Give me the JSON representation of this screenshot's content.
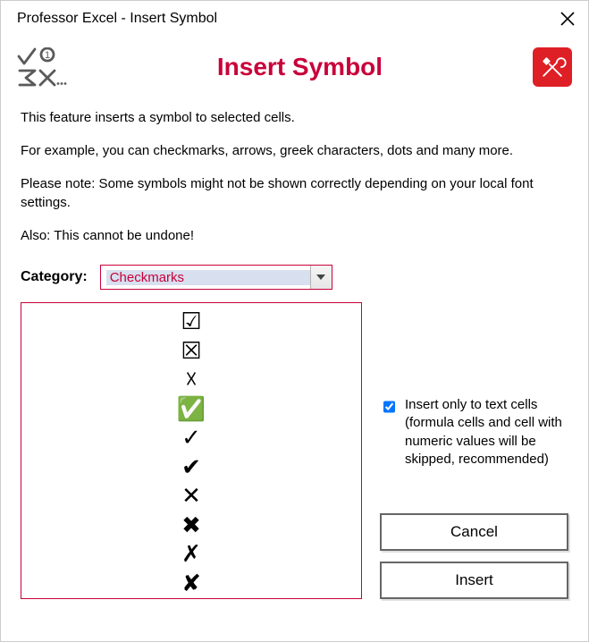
{
  "window": {
    "title": "Professor Excel - Insert Symbol"
  },
  "header": {
    "title": "Insert Symbol"
  },
  "description": {
    "p1": "This feature inserts a symbol to selected cells.",
    "p2": "For example, you can checkmarks, arrows, greek characters, dots and many more.",
    "p3": "Please note: Some symbols might not be shown correctly depending on your local font settings.",
    "p4": "Also: This cannot be undone!"
  },
  "category": {
    "label": "Category:",
    "value": "Checkmarks"
  },
  "symbols": [
    "☑",
    "☒",
    "☓",
    "✅",
    "✓",
    "✔",
    "✕",
    "✖",
    "✗",
    "✘"
  ],
  "option": {
    "text": "Insert only to text cells (formula cells and cell with numeric values will be skipped, recommended)",
    "checked": true
  },
  "buttons": {
    "cancel": "Cancel",
    "insert": "Insert"
  }
}
